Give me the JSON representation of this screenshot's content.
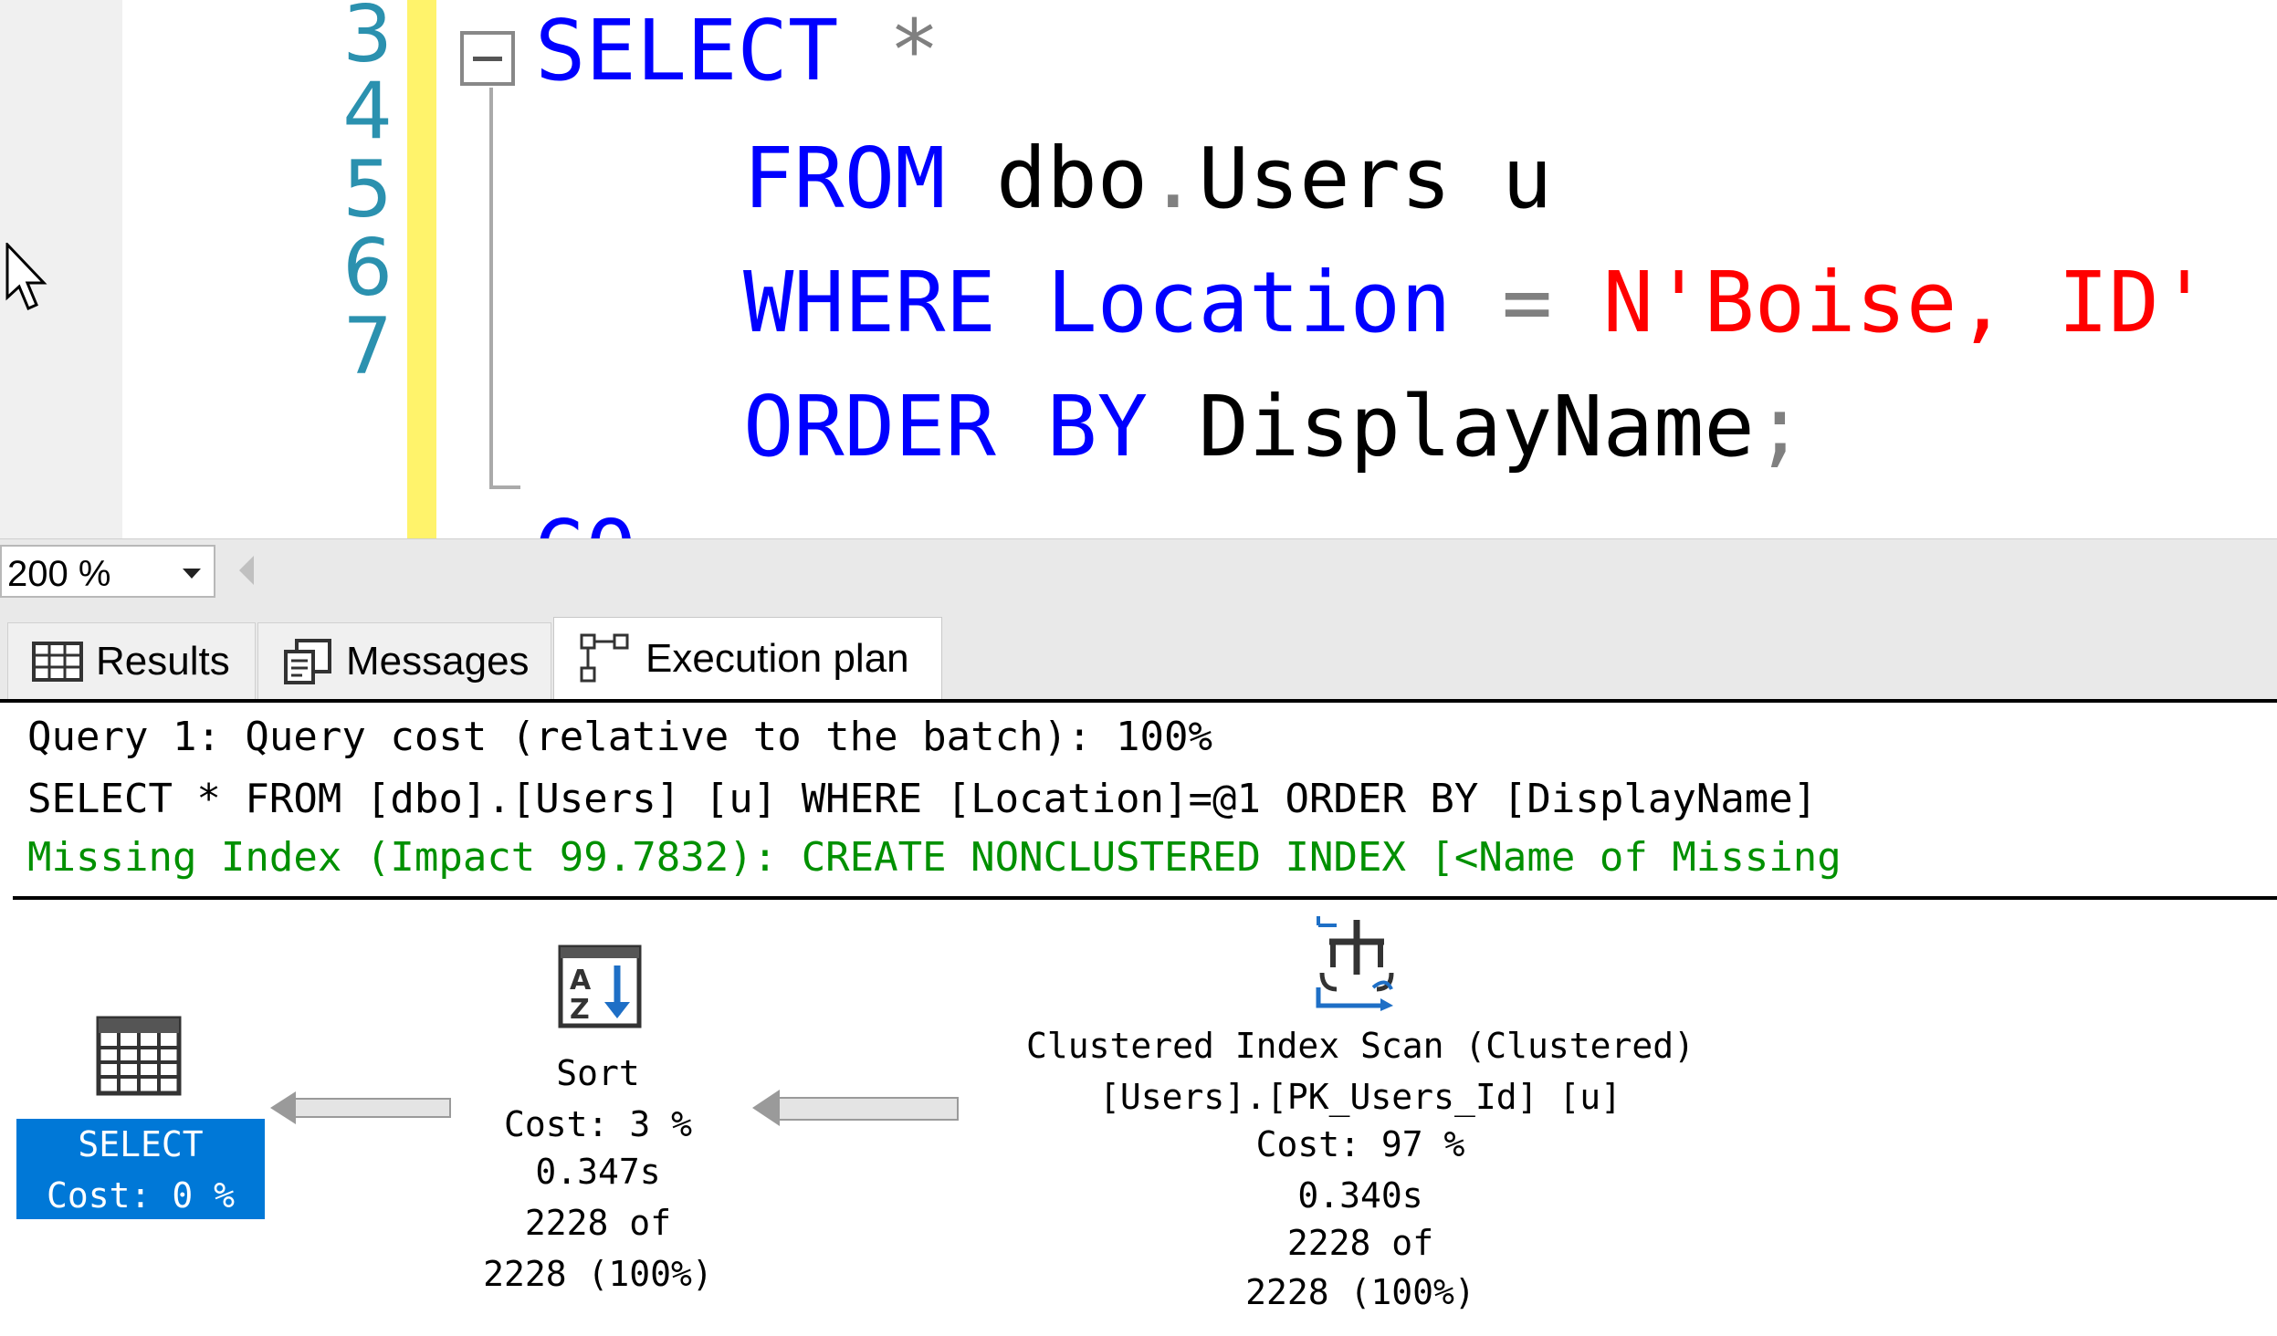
{
  "editor": {
    "line_numbers": [
      "3",
      "4",
      "5",
      "6",
      "7"
    ],
    "lines": [
      [
        {
          "t": "SELECT",
          "c": "kw"
        },
        {
          "t": " ",
          "c": "id"
        },
        {
          "t": "*",
          "c": "op"
        }
      ],
      [
        {
          "t": "FROM",
          "c": "kw"
        },
        {
          "t": " dbo",
          "c": "id"
        },
        {
          "t": ".",
          "c": "op"
        },
        {
          "t": "Users u",
          "c": "id"
        }
      ],
      [
        {
          "t": "WHERE",
          "c": "kw"
        },
        {
          "t": " ",
          "c": "id"
        },
        {
          "t": "Location",
          "c": "kw"
        },
        {
          "t": " ",
          "c": "id"
        },
        {
          "t": "=",
          "c": "op"
        },
        {
          "t": " ",
          "c": "id"
        },
        {
          "t": "N'Boise, ID'",
          "c": "str"
        }
      ],
      [
        {
          "t": "ORDER",
          "c": "kw"
        },
        {
          "t": " ",
          "c": "id"
        },
        {
          "t": "BY",
          "c": "kw"
        },
        {
          "t": " DisplayName",
          "c": "id"
        },
        {
          "t": ";",
          "c": "op"
        }
      ],
      [
        {
          "t": "GO",
          "c": "kw"
        }
      ]
    ]
  },
  "zoom": {
    "value": "200 %"
  },
  "tabs": [
    {
      "label": "Results",
      "icon": "grid-icon"
    },
    {
      "label": "Messages",
      "icon": "messages-icon"
    },
    {
      "label": "Execution plan",
      "icon": "execution-plan-icon",
      "active": true
    }
  ],
  "plan": {
    "query_header": "Query 1: Query cost (relative to the batch): 100%",
    "query_text": "SELECT * FROM [dbo].[Users] [u] WHERE [Location]=@1 ORDER BY [DisplayName]",
    "missing_index": "Missing Index (Impact 99.7832): CREATE NONCLUSTERED INDEX [<Name of Missing",
    "operators": {
      "select": {
        "name": "SELECT",
        "cost": "Cost: 0 %",
        "icon": "select-result-icon"
      },
      "sort": {
        "name": "Sort",
        "cost": "Cost: 3 %",
        "time": "0.347s",
        "rows_line1": "2228 of",
        "rows_line2": "2228 (100%)",
        "icon": "sort-az-icon"
      },
      "scan": {
        "name": "Clustered Index Scan (Clustered)",
        "object": "[Users].[PK_Users_Id] [u]",
        "cost": "Cost: 97 %",
        "time": "0.340s",
        "rows_line1": "2228 of",
        "rows_line2": "2228 (100%)",
        "icon": "clustered-index-scan-icon"
      }
    }
  },
  "colors": {
    "selected_operator": "#0078d7",
    "missing_index": "#009000",
    "keyword": "#0000ff",
    "string": "#ff0000",
    "line_number": "#2b91af",
    "change_bar": "#fff36b"
  }
}
